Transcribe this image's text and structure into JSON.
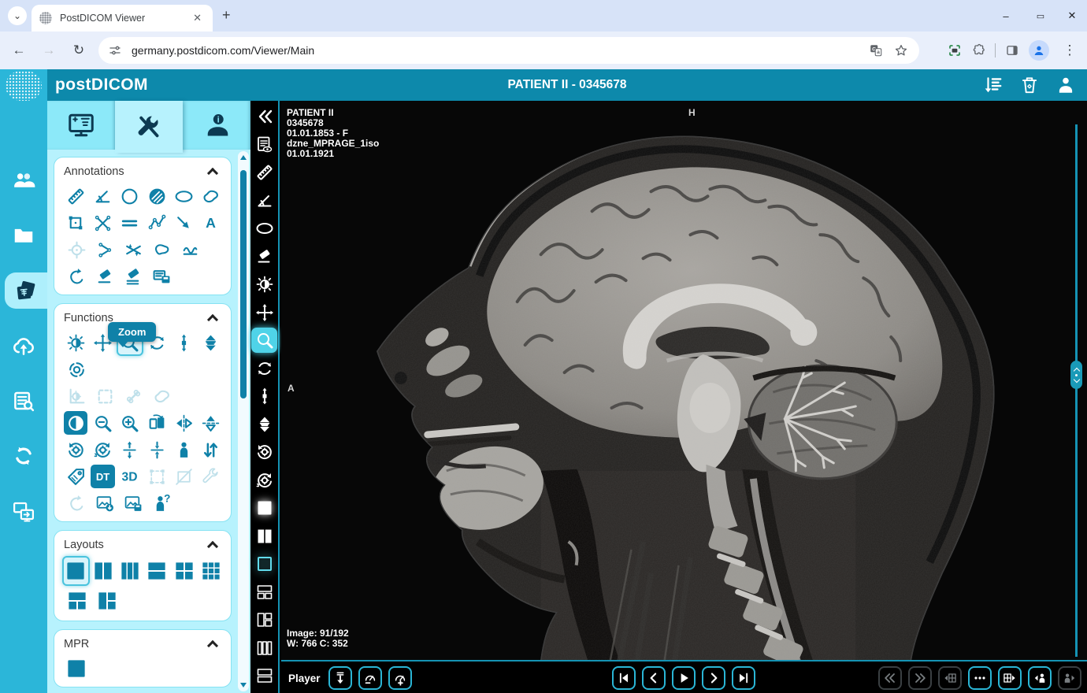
{
  "browser": {
    "tab_title": "PostDICOM Viewer",
    "url": "germany.postdicom.com/Viewer/Main",
    "window_controls": [
      "minimize",
      "maximize",
      "close"
    ],
    "toolbar_icons": [
      "back-arrow",
      "forward-arrow",
      "reload",
      "site-settings",
      "translate",
      "bookmark-star",
      "screen-capture",
      "extensions-puzzle",
      "side-panel",
      "profile-avatar",
      "menu-dots"
    ]
  },
  "header": {
    "logo": "postDICOM",
    "title": "PATIENT II - 0345678",
    "actions": [
      {
        "i": "sort-list"
      },
      {
        "i": "trash"
      },
      {
        "i": "user"
      }
    ]
  },
  "rail": {
    "items": [
      {
        "i": "patients"
      },
      {
        "i": "folder"
      },
      {
        "i": "images",
        "s": "active"
      },
      {
        "i": "cloud-upload"
      },
      {
        "i": "worklist"
      },
      {
        "i": "sync"
      },
      {
        "i": "share-screens"
      }
    ]
  },
  "tabs": {
    "items": [
      {
        "i": "viewer-monitor"
      },
      {
        "i": "tools",
        "s": "active"
      },
      {
        "i": "user-info"
      }
    ]
  },
  "tooltip": {
    "label": "Zoom"
  },
  "panel": {
    "annotations": {
      "title": "Annotations",
      "rows": [
        [
          {
            "i": "ruler"
          },
          {
            "i": "angle"
          },
          {
            "i": "circle"
          },
          {
            "i": "circle-fill"
          },
          {
            "i": "ellipse"
          },
          {
            "i": "freehand"
          }
        ],
        [
          {
            "i": "rect"
          },
          {
            "i": "cross"
          },
          {
            "i": "parallel"
          },
          {
            "i": "polyline"
          },
          {
            "i": "arrow"
          },
          {
            "i": "text"
          }
        ],
        [
          {
            "i": "probe",
            "s": "disabled"
          },
          {
            "i": "open-angle"
          },
          {
            "i": "cobb"
          },
          {
            "i": "region"
          },
          {
            "i": "wave"
          }
        ],
        [
          {
            "i": "undo"
          },
          {
            "i": "eraser"
          },
          {
            "i": "erase-all"
          },
          {
            "i": "save-annot"
          }
        ]
      ]
    },
    "functions": {
      "title": "Functions",
      "rows": [
        [
          {
            "i": "window-level"
          },
          {
            "i": "pan"
          },
          {
            "i": "zoom",
            "s": "selected"
          },
          {
            "i": "rotate"
          },
          {
            "i": "stack-scroll"
          },
          {
            "i": "cine"
          }
        ],
        [
          {
            "i": "target"
          }
        ],
        [
          {
            "i": "histogram",
            "s": "disabled"
          },
          {
            "i": "roi-rect",
            "s": "disabled"
          },
          {
            "i": "bone",
            "s": "disabled"
          },
          {
            "i": "freehand",
            "s": "disabled"
          }
        ],
        [
          {
            "i": "invert",
            "s": "active"
          },
          {
            "i": "zoom-out"
          },
          {
            "i": "zoom-in"
          },
          {
            "i": "flip-page"
          },
          {
            "i": "flip-h"
          },
          {
            "i": "flip-v"
          }
        ],
        [
          {
            "i": "rotate-ccw-gear"
          },
          {
            "i": "rotate-cw-gear"
          },
          {
            "i": "expand-v"
          },
          {
            "i": "collapse-v"
          },
          {
            "i": "patient-orient"
          },
          {
            "i": "swap-v"
          }
        ],
        [
          {
            "i": "tag"
          },
          {
            "i": "dt",
            "s": "active"
          },
          {
            "i": "three-d"
          },
          {
            "i": "bbox",
            "s": "disabled"
          },
          {
            "i": "crop",
            "s": "disabled"
          },
          {
            "i": "fix",
            "s": "disabled"
          }
        ],
        [
          {
            "i": "undo",
            "s": "disabled"
          },
          {
            "i": "export-image"
          },
          {
            "i": "save-image"
          },
          {
            "i": "patient-help"
          }
        ]
      ]
    },
    "layouts": {
      "title": "Layouts",
      "rows": [
        [
          {
            "i": "L1x1",
            "s": "selected"
          },
          {
            "i": "L2col"
          },
          {
            "i": "L3col"
          },
          {
            "i": "L2row"
          },
          {
            "i": "L2x2"
          },
          {
            "i": "L3x3"
          }
        ],
        [
          {
            "i": "L1-2b"
          },
          {
            "i": "L1-2r"
          }
        ]
      ]
    },
    "mpr": {
      "title": "MPR",
      "rows": [
        [
          {
            "i": "L1x1"
          }
        ]
      ]
    }
  },
  "vtoolbar": {
    "items": [
      {
        "i": "collapse-panel"
      },
      {
        "i": "report-view"
      },
      {
        "i": "ruler"
      },
      {
        "i": "angle"
      },
      {
        "i": "ellipse"
      },
      {
        "i": "eraser"
      },
      {
        "i": "window-level"
      },
      {
        "i": "pan"
      },
      {
        "i": "zoom",
        "s": "selected"
      },
      {
        "i": "rotate"
      },
      {
        "i": "stack-scroll"
      },
      {
        "i": "cine"
      },
      {
        "i": "rotate-ccw-gear"
      },
      {
        "i": "rotate-cw-gear"
      },
      {
        "i": "L1x1",
        "s": "white-glow"
      },
      {
        "i": "L2col"
      },
      {
        "i": "Lo-sq",
        "s": "hl"
      },
      {
        "i": "Lo-1-2b"
      },
      {
        "i": "Lo-1-2r"
      },
      {
        "i": "Lo-3col"
      },
      {
        "i": "Lo-2row"
      }
    ]
  },
  "viewer": {
    "overlay_top_left": [
      "PATIENT II",
      "0345678",
      "01.01.1853 - F",
      "dzne_MPRAGE_1iso",
      "01.01.1921"
    ],
    "orientation_top": "H",
    "orientation_left": "A",
    "image_counter": "Image: 91/192",
    "window_level": "W: 766 C: 352"
  },
  "player": {
    "label": "Player",
    "left": [
      {
        "i": "play-mode"
      },
      {
        "i": "speed-down"
      },
      {
        "i": "speed-up"
      }
    ],
    "transport": [
      {
        "i": "first"
      },
      {
        "i": "prev"
      },
      {
        "i": "play"
      },
      {
        "i": "next"
      },
      {
        "i": "last"
      }
    ],
    "right": [
      {
        "i": "series-prev",
        "s": "disabled"
      },
      {
        "i": "series-next",
        "s": "disabled"
      },
      {
        "i": "grid-prev",
        "s": "disabled"
      },
      {
        "i": "more"
      },
      {
        "i": "grid-next"
      },
      {
        "i": "patient-prev"
      },
      {
        "i": "patient-next",
        "s": "disabled"
      }
    ]
  },
  "colors": {
    "header_teal": "#0d89ab",
    "rail_teal": "#2bb6d9",
    "panel_cyan": "#b7f2fd",
    "tab_cyan": "#8ce9f9",
    "icon_teal": "#0f81a8",
    "selected_cyan": "#4fd3e8",
    "icon_navy": "#0c3a52",
    "viewer_border": "#1593b4"
  }
}
